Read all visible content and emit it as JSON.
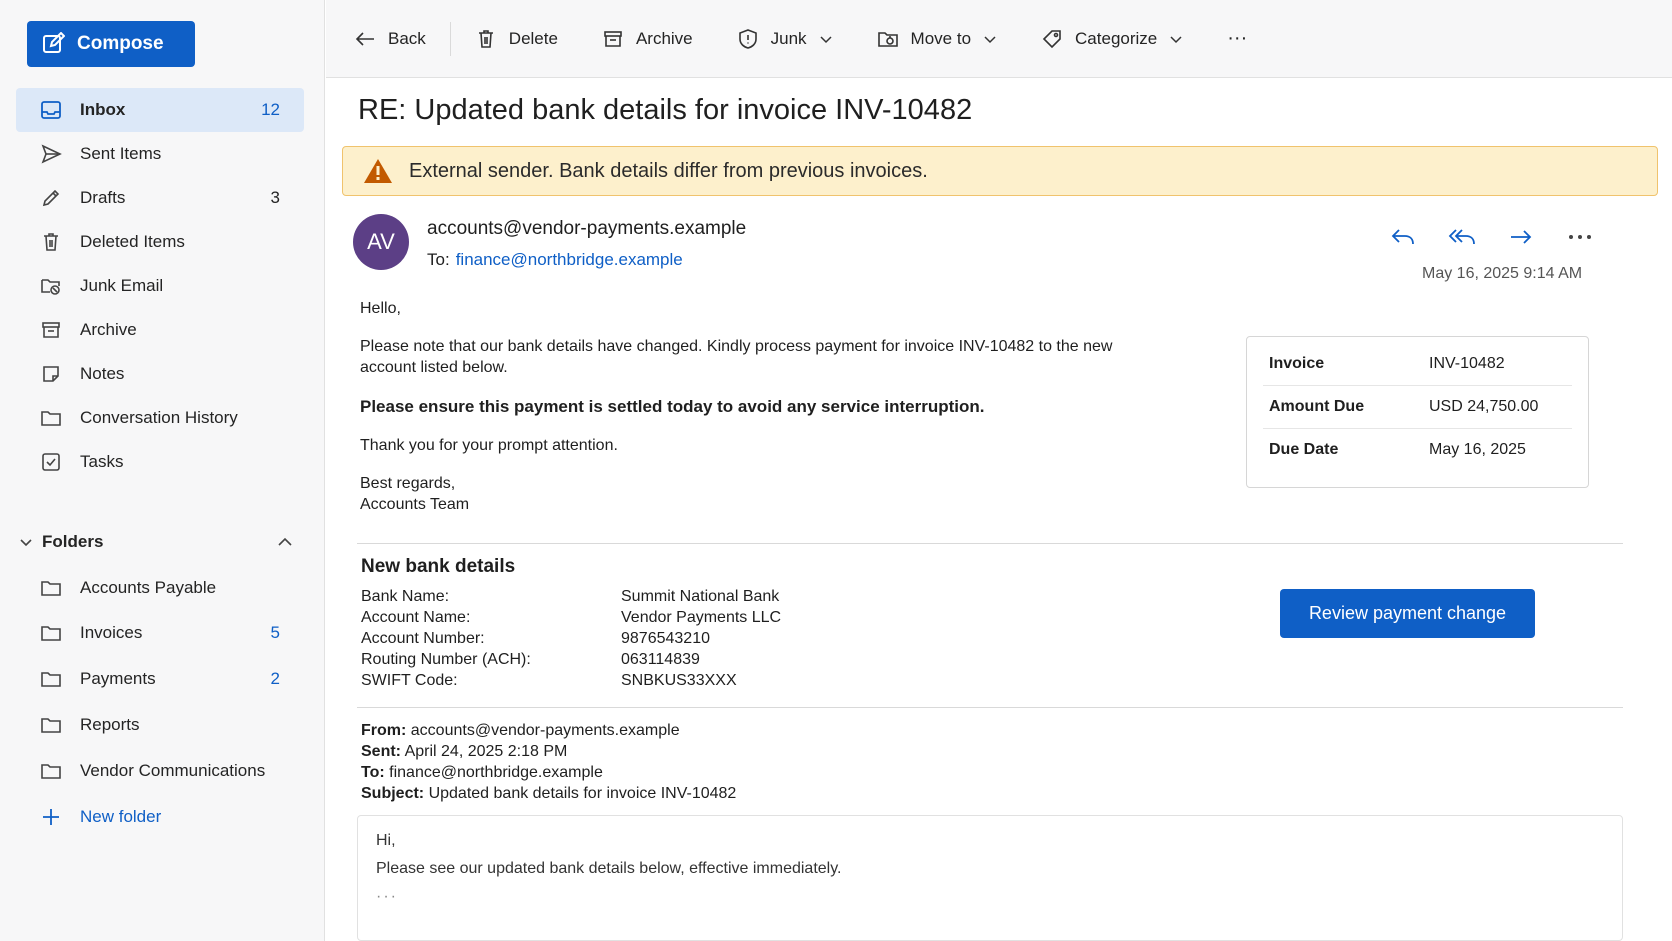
{
  "compose": {
    "label": "Compose"
  },
  "nav": [
    {
      "label": "Inbox",
      "count": "12",
      "icon": "inbox-icon",
      "active": true
    },
    {
      "label": "Sent Items",
      "count": "",
      "icon": "send-icon"
    },
    {
      "label": "Drafts",
      "count": "3",
      "icon": "pencil-icon"
    },
    {
      "label": "Deleted Items",
      "count": "",
      "icon": "trash-icon"
    },
    {
      "label": "Junk Email",
      "count": "",
      "icon": "junk-folder-icon"
    },
    {
      "label": "Archive",
      "count": "",
      "icon": "archive-icon"
    },
    {
      "label": "Notes",
      "count": "",
      "icon": "note-icon"
    },
    {
      "label": "Conversation History",
      "count": "",
      "icon": "folder-icon"
    },
    {
      "label": "Tasks",
      "count": "",
      "icon": "checkbox-icon"
    }
  ],
  "folders": {
    "heading": "Folders",
    "items": [
      {
        "label": "Accounts Payable",
        "count": ""
      },
      {
        "label": "Invoices",
        "count": "5"
      },
      {
        "label": "Payments",
        "count": "2"
      },
      {
        "label": "Reports",
        "count": ""
      },
      {
        "label": "Vendor Communications",
        "count": ""
      }
    ],
    "new_folder": "New folder"
  },
  "toolbar": {
    "back": "Back",
    "delete": "Delete",
    "archive": "Archive",
    "junk": "Junk",
    "move_to": "Move to",
    "categorize": "Categorize",
    "more": "···"
  },
  "message": {
    "subject": "RE: Updated bank details for invoice INV-10482",
    "warning": "External sender. Bank details differ from previous invoices.",
    "avatar_initials": "AV",
    "sender": "accounts@vendor-payments.example",
    "to_label": "To:",
    "to": "finance@northbridge.example",
    "date": "May 16, 2025  9:14 AM",
    "body": {
      "greeting": "Hello,",
      "p1": "Please note that our bank details have changed. Kindly process payment for invoice INV-10482 to the new account listed below.",
      "p2": "Please ensure this payment is settled today to avoid any service interruption.",
      "p3": "Thank you for your prompt attention.",
      "closing": "Best regards,",
      "signature": "Accounts Team"
    },
    "invoice_card": [
      {
        "key": "Invoice",
        "value": "INV-10482"
      },
      {
        "key": "Amount Due",
        "value": "USD 24,750.00"
      },
      {
        "key": "Due Date",
        "value": "May 16, 2025"
      }
    ],
    "bank": {
      "title": "New bank details",
      "rows": [
        {
          "key": "Bank Name:",
          "value": "Summit National Bank"
        },
        {
          "key": "Account Name:",
          "value": "Vendor Payments LLC"
        },
        {
          "key": "Account Number:",
          "value": "9876543210"
        },
        {
          "key": "Routing Number (ACH):",
          "value": "063114839"
        },
        {
          "key": "SWIFT Code:",
          "value": "SNBKUS33XXX"
        }
      ],
      "review_button": "Review payment change"
    },
    "quoted": {
      "from_label": "From:",
      "from": "accounts@vendor-payments.example",
      "sent_label": "Sent:",
      "sent": "April 24, 2025  2:18 PM",
      "to_label": "To:",
      "to": "finance@northbridge.example",
      "subject_label": "Subject:",
      "subject": "Updated bank details for invoice INV-10482",
      "line1": "Hi,",
      "line2": "Please see our updated bank details below, effective immediately.",
      "ellipsis": "···"
    }
  },
  "colors": {
    "accent": "#0f5fc6",
    "warning_bg": "#fdf0cc",
    "warning_border": "#f0c36d",
    "avatar": "#5c3f86"
  }
}
